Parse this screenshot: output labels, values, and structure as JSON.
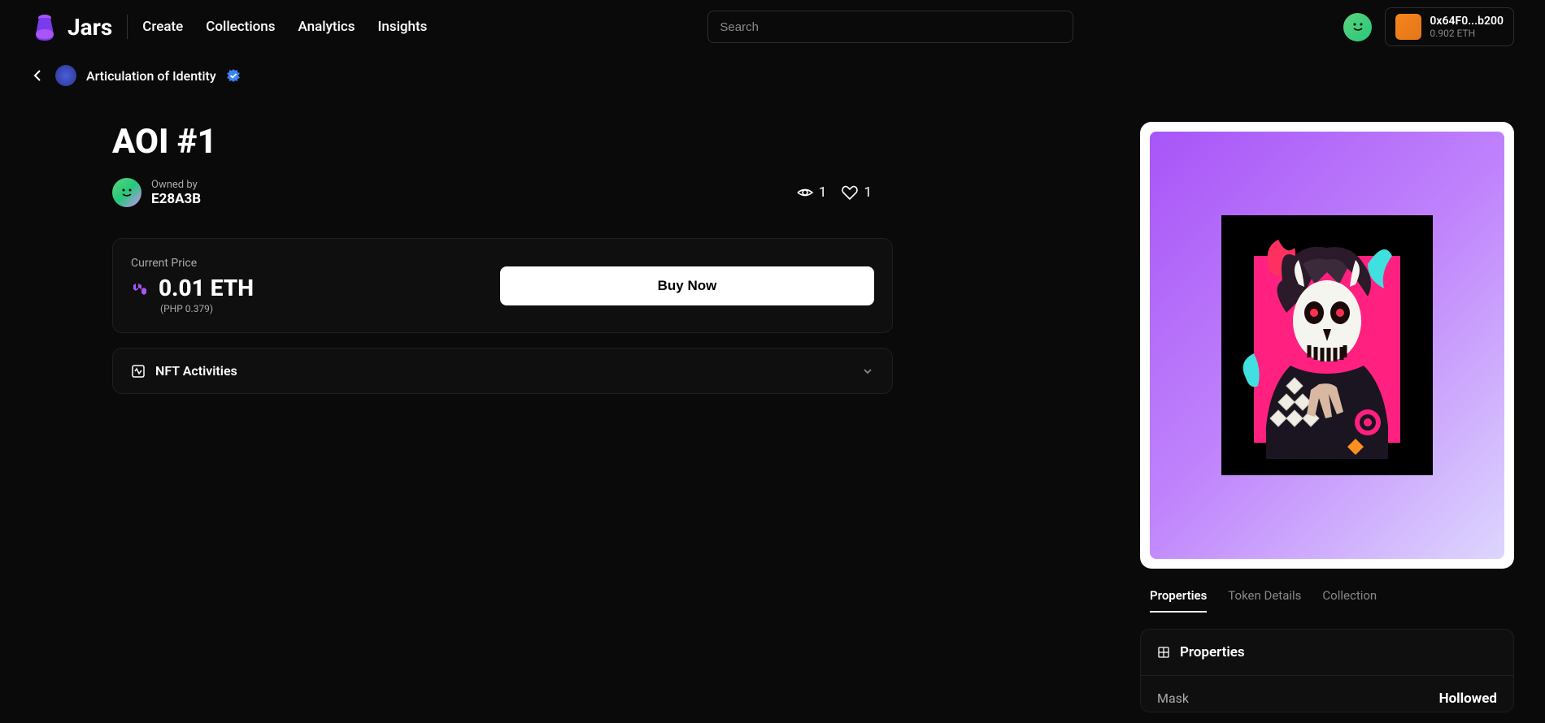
{
  "header": {
    "brand": "Jars",
    "nav": [
      "Create",
      "Collections",
      "Analytics",
      "Insights"
    ],
    "search_placeholder": "Search",
    "wallet_address": "0x64F0...b200",
    "wallet_balance": "0.902 ETH"
  },
  "breadcrumb": {
    "collection_name": "Articulation of Identity"
  },
  "nft": {
    "title": "AOI #1",
    "owned_by_label": "Owned by",
    "owner": "E28A3B",
    "views": "1",
    "likes": "1"
  },
  "price": {
    "label": "Current Price",
    "value": "0.01 ETH",
    "fiat": "(PHP 0.379)",
    "buy_label": "Buy Now"
  },
  "activities": {
    "label": "NFT Activities"
  },
  "tabs": [
    "Properties",
    "Token Details",
    "Collection"
  ],
  "properties_panel": {
    "header": "Properties",
    "items": [
      {
        "key": "Mask",
        "value": "Hollowed"
      }
    ]
  }
}
